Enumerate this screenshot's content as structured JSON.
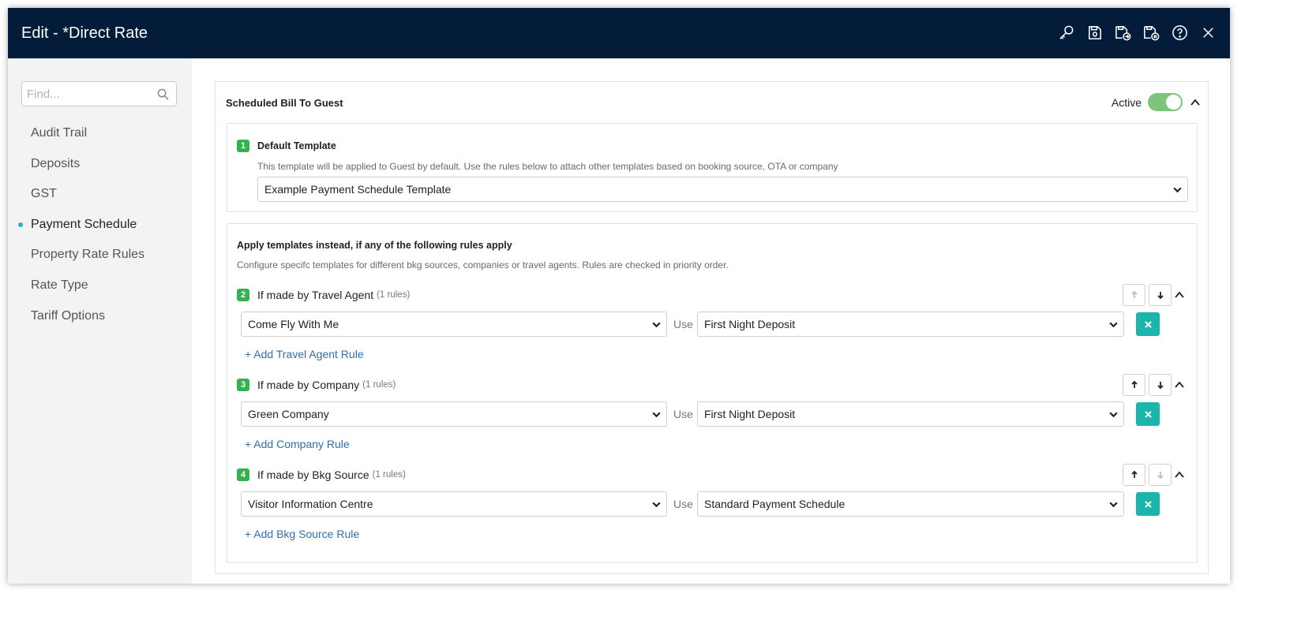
{
  "window": {
    "title": "Edit - *Direct Rate"
  },
  "title_actions": [
    {
      "icon": "key-icon"
    },
    {
      "icon": "save-icon"
    },
    {
      "icon": "save-and-new-icon"
    },
    {
      "icon": "save-and-close-icon"
    },
    {
      "icon": "help-icon"
    },
    {
      "icon": "close-icon"
    }
  ],
  "sidebar": {
    "search_placeholder": "Find...",
    "items": [
      {
        "label": "Audit Trail"
      },
      {
        "label": "Deposits"
      },
      {
        "label": "GST"
      },
      {
        "label": "Payment Schedule",
        "active": true
      },
      {
        "label": "Property Rate Rules"
      },
      {
        "label": "Rate Type"
      },
      {
        "label": "Tariff Options"
      }
    ]
  },
  "section": {
    "title": "Scheduled Bill To Guest",
    "active_label": "Active",
    "active": true
  },
  "default_template": {
    "number": "1",
    "title": "Default Template",
    "description": "This template will be applied to Guest by default. Use the rules below to attach other templates based on booking source, OTA or company",
    "selected": "Example Payment Schedule Template"
  },
  "rules": {
    "title": "Apply templates instead, if any of the following rules apply",
    "description": "Configure specifc templates for different bkg sources, companies or travel agents. Rules are checked in priority order.",
    "use_label": "Use",
    "groups": [
      {
        "number": "2",
        "title": "If made by Travel Agent",
        "count": "(1 rules)",
        "source": "Come Fly With Me",
        "template": "First Night Deposit",
        "add_label": "+ Add Travel Agent Rule",
        "up_enabled": false,
        "down_enabled": true
      },
      {
        "number": "3",
        "title": "If made by Company",
        "count": "(1 rules)",
        "source": "Green Company",
        "template": "First Night Deposit",
        "add_label": "+ Add Company Rule",
        "up_enabled": true,
        "down_enabled": true
      },
      {
        "number": "4",
        "title": "If made by Bkg Source",
        "count": "(1 rules)",
        "source": "Visitor Information Centre",
        "template": "Standard Payment Schedule",
        "add_label": "+ Add Bkg Source Rule",
        "up_enabled": true,
        "down_enabled": false
      }
    ]
  },
  "colors": {
    "titlebar": "#031c3a",
    "accent_teal": "#1cb5ad",
    "number_badge": "#34b24f",
    "toggle_on": "#7cc57b",
    "link": "#2f6fb0"
  }
}
